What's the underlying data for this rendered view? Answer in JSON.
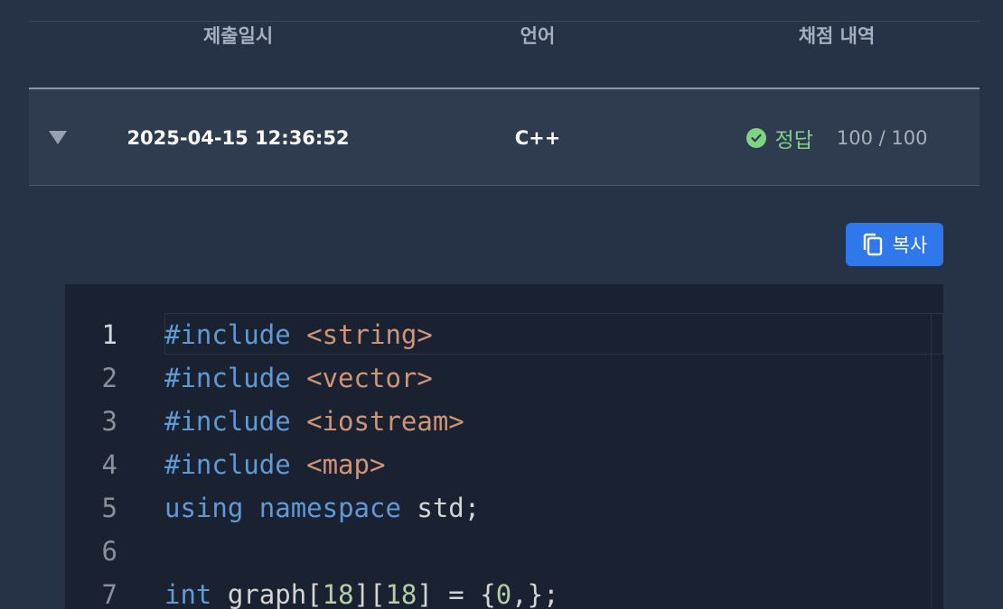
{
  "table": {
    "headers": {
      "date": "제출일시",
      "language": "언어",
      "result": "채점 내역"
    },
    "row": {
      "date": "2025-04-15 12:36:52",
      "language": "C++",
      "verdict": "정답",
      "score": "100 / 100"
    }
  },
  "copy_button": {
    "label": "복사"
  },
  "code": {
    "line_numbers": [
      "1",
      "2",
      "3",
      "4",
      "5",
      "6",
      "7"
    ],
    "lines": [
      [
        {
          "t": "#include ",
          "c": "kw"
        },
        {
          "t": "<string>",
          "c": "str"
        }
      ],
      [
        {
          "t": "#include ",
          "c": "kw"
        },
        {
          "t": "<vector>",
          "c": "str"
        }
      ],
      [
        {
          "t": "#include ",
          "c": "kw"
        },
        {
          "t": "<iostream>",
          "c": "str"
        }
      ],
      [
        {
          "t": "#include ",
          "c": "kw"
        },
        {
          "t": "<map>",
          "c": "str"
        }
      ],
      [
        {
          "t": "using",
          "c": "kw"
        },
        {
          "t": " ",
          "c": ""
        },
        {
          "t": "namespace",
          "c": "kw"
        },
        {
          "t": " std;",
          "c": ""
        }
      ],
      [],
      [
        {
          "t": "int",
          "c": "kw"
        },
        {
          "t": " graph[",
          "c": ""
        },
        {
          "t": "18",
          "c": "num"
        },
        {
          "t": "][",
          "c": ""
        },
        {
          "t": "18",
          "c": "num"
        },
        {
          "t": "] = {",
          "c": ""
        },
        {
          "t": "0",
          "c": "num"
        },
        {
          "t": ",};",
          "c": ""
        }
      ]
    ]
  },
  "colors": {
    "background": "#263245",
    "row_background": "#2f3c50",
    "accent": "#2f78ec",
    "success": "#7fd483",
    "code_background": "#1a2232"
  }
}
